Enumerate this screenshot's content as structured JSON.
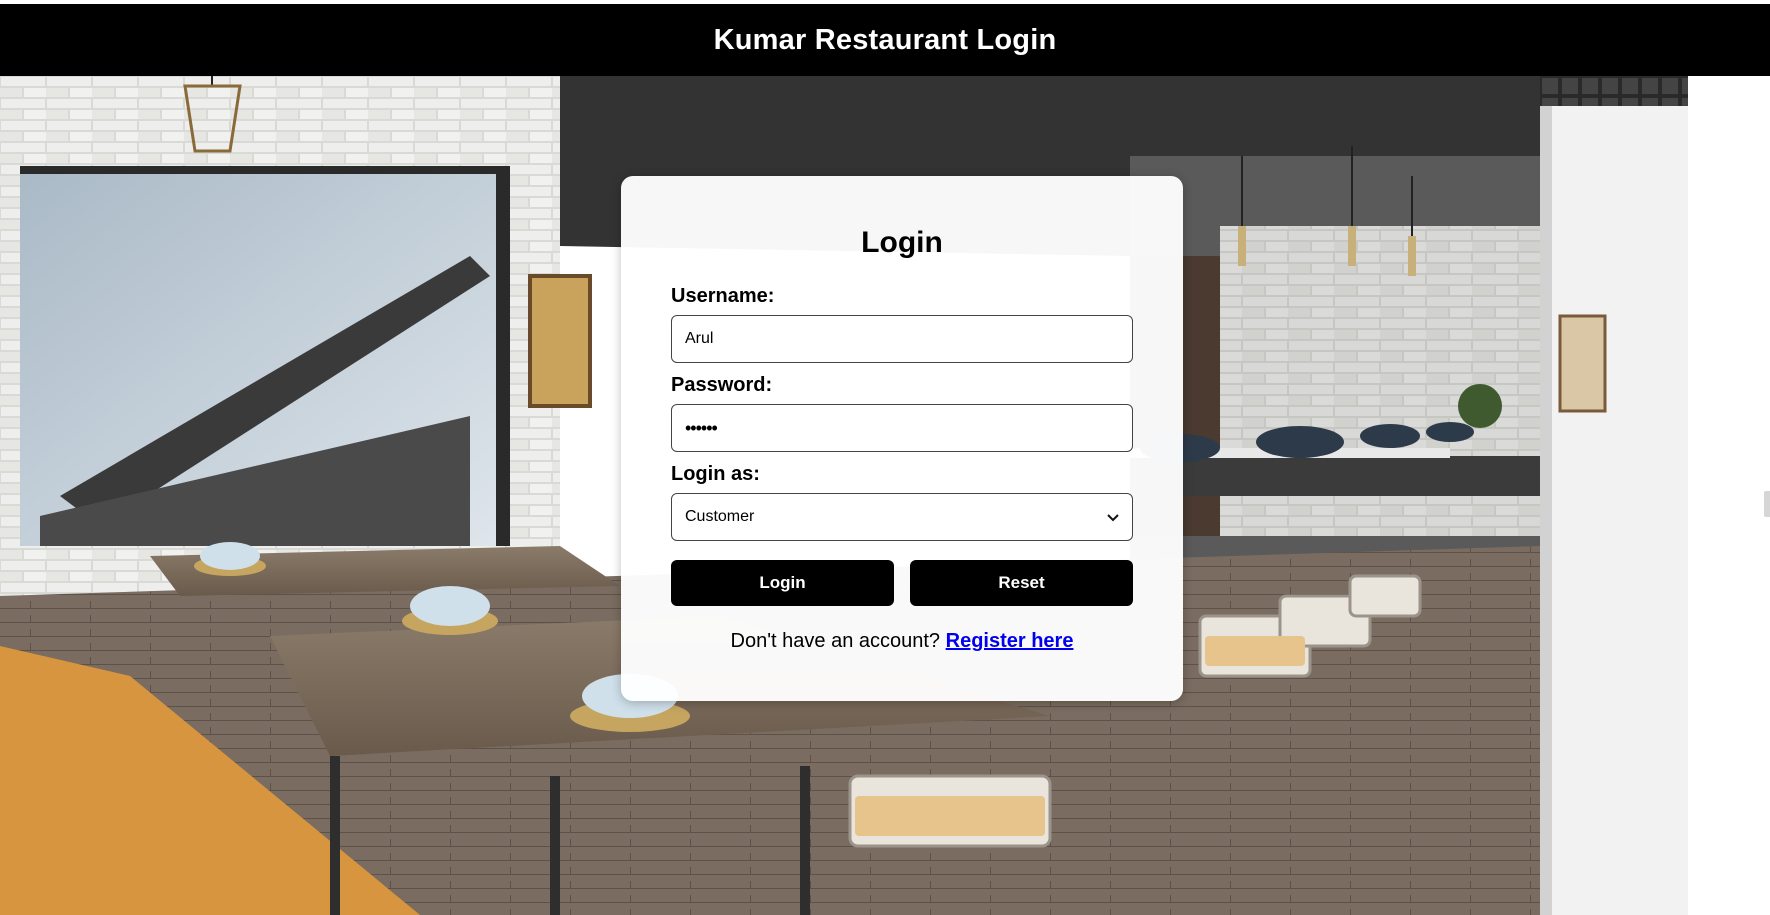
{
  "header": {
    "title": "Kumar Restaurant Login"
  },
  "login_card": {
    "title": "Login",
    "username_label": "Username:",
    "username_value": "Arul",
    "password_label": "Password:",
    "password_value": "••••••",
    "role_label": "Login as:",
    "role_selected": "Customer",
    "login_button": "Login",
    "reset_button": "Reset",
    "register_prompt": "Don't have an account?",
    "register_link": "Register here"
  },
  "icons": {
    "select_chevron": "chevron-down-icon"
  },
  "colors": {
    "header_bg": "#000000",
    "button_bg": "#000000",
    "link": "#0000ee"
  }
}
